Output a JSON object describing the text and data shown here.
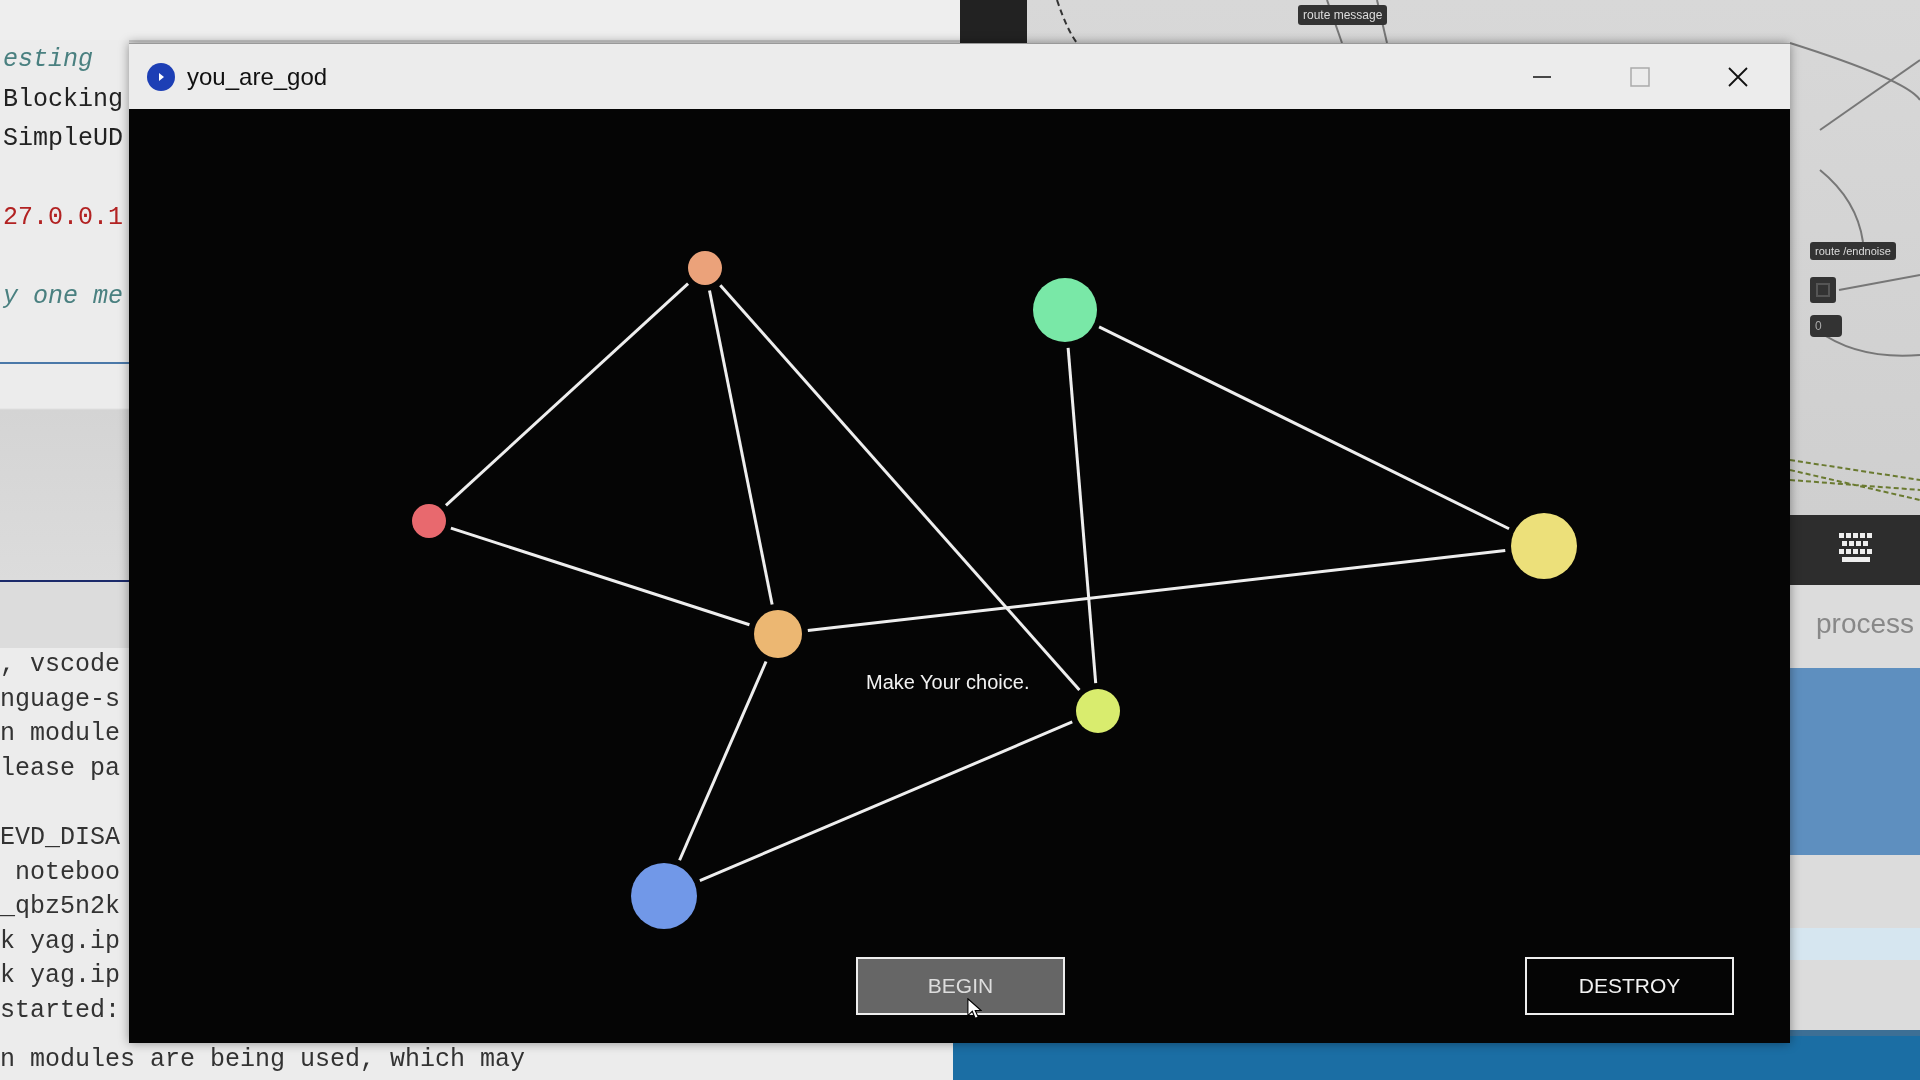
{
  "editor": {
    "lines": [
      {
        "text": "esting",
        "kind": "comment"
      },
      {
        "text": "Blocking",
        "kind": "code"
      },
      {
        "text": "SimpleUD",
        "kind": "code"
      },
      {
        "text": "27.0.0.1",
        "kind": "string"
      },
      {
        "text": "y one me",
        "kind": "comment"
      }
    ]
  },
  "terminal": {
    "lines": [
      ", vscode",
      "nguage-s",
      "n module",
      "lease pa",
      "EVD_DISA",
      " noteboo",
      "_qbz5n2k",
      "k yag.ip",
      "k yag.ip",
      "started:"
    ],
    "last_line": "n modules are being used, which may"
  },
  "patcher": {
    "objects": [
      "route message",
      "route /endnoise"
    ],
    "number_box": "0",
    "panel_label": "process"
  },
  "window": {
    "title": "you_are_god",
    "message": "Make Your choice.",
    "nodes": [
      {
        "color": "#eba27a"
      },
      {
        "color": "#79e8a7"
      },
      {
        "color": "#e8696e"
      },
      {
        "color": "#ecb772"
      },
      {
        "color": "#ece07a"
      },
      {
        "color": "#d9ec6e"
      },
      {
        "color": "#7198e8"
      }
    ],
    "buttons": [
      {
        "label": "BEGIN",
        "hovered": true
      },
      {
        "label": "DESTROY",
        "hovered": false
      }
    ]
  }
}
